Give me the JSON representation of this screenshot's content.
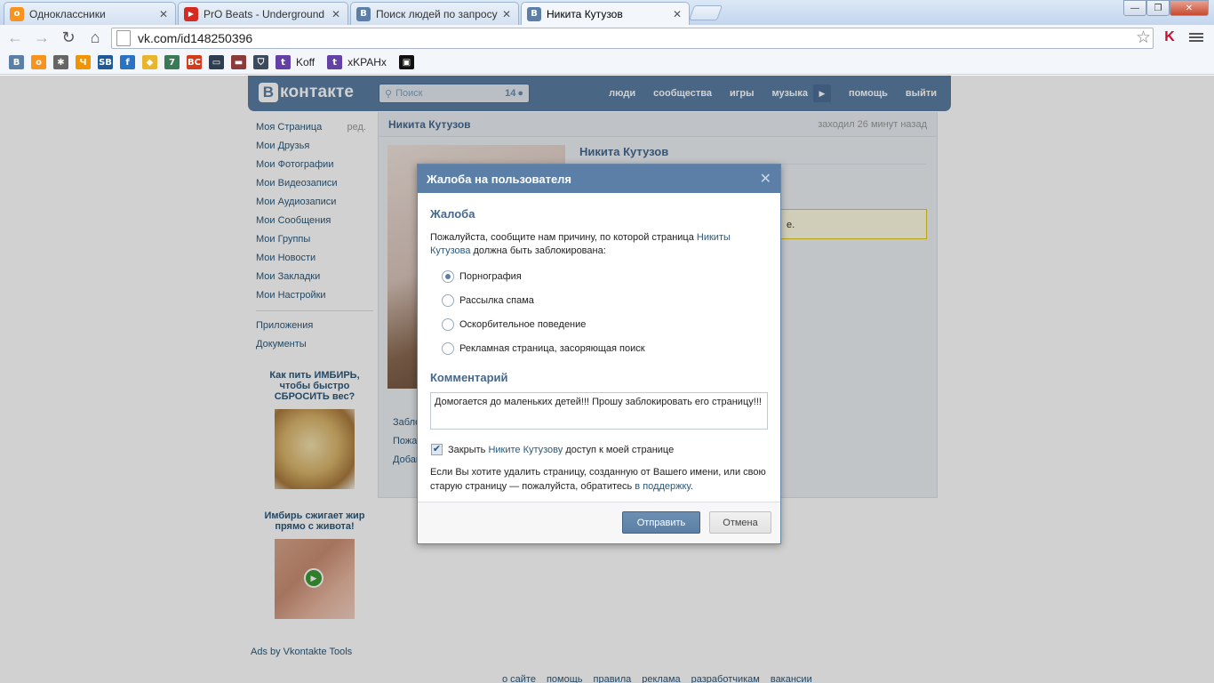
{
  "browser": {
    "tabs": [
      {
        "title": "Одноклассники",
        "icon": "odnoklassniki-icon",
        "color": "#f7931e",
        "glyph": "о"
      },
      {
        "title": "PrO Beats - Underground",
        "icon": "youtube-icon",
        "color": "#d42a20",
        "glyph": "▶"
      },
      {
        "title": "Поиск людей по запросу",
        "icon": "vk-icon",
        "color": "#5b7fa6",
        "glyph": "B"
      },
      {
        "title": "Никита Кутузов",
        "icon": "vk-icon",
        "color": "#5b7fa6",
        "glyph": "B"
      }
    ],
    "close_glyph": "✕",
    "url": "vk.com/id148250396",
    "bookmarks": {
      "koff": "Koff",
      "xkran": "xKPAHx"
    }
  },
  "vk": {
    "logo": "контакте",
    "logo_letter": "B",
    "search_placeholder": "Поиск",
    "search_count": "14",
    "nav": [
      "люди",
      "сообщества",
      "игры",
      "музыка",
      "помощь",
      "выйти"
    ],
    "menu": [
      "Моя Страница",
      "Мои Друзья",
      "Мои Фотографии",
      "Мои Видеозаписи",
      "Мои Аудиозаписи",
      "Мои Сообщения",
      "Мои Группы",
      "Мои Новости",
      "Мои Закладки",
      "Мои Настройки"
    ],
    "menu_edit": "ред.",
    "menu_extra": [
      "Приложения",
      "Документы"
    ],
    "ad1": "Как пить ИМБИРЬ, чтобы быстро СБРОСИТЬ вес?",
    "ad2": "Имбирь сжигает жир прямо с живота!",
    "ads_by": "Ads by Vkontakte Tools",
    "profile": {
      "name": "Никита Кутузов",
      "last_seen": "заходил 26 минут назад",
      "notice_tail": "е.",
      "side_actions": [
        "Забло",
        "Пожа",
        "Добав"
      ]
    },
    "footer": [
      "о сайте",
      "помощь",
      "правила",
      "реклама",
      "разработчикам",
      "вакансии"
    ]
  },
  "modal": {
    "title": "Жалоба на пользователя",
    "close": "✕",
    "section_complaint": "Жалоба",
    "desc_pre": "Пожалуйста, сообщите нам причину, по которой страница ",
    "desc_link": "Никиты Кутузова",
    "desc_post": " должна быть заблокирована:",
    "reasons": [
      "Порнография",
      "Рассылка спама",
      "Оскорбительное поведение",
      "Рекламная страница, засоряющая поиск"
    ],
    "selected_reason": 0,
    "section_comment": "Комментарий",
    "comment": "Домогается до маленьких детей!!! Прошу заблокировать его страницу!!!",
    "close_access_pre": "Закрыть ",
    "close_access_link": "Никите Кутузову",
    "close_access_post": " доступ к моей странице",
    "close_access_checked": true,
    "note_pre": "Если Вы хотите удалить страницу, созданную от Вашего имени, или свою старую страницу — пожалуйста, обратитесь ",
    "note_link": "в поддержку",
    "note_post": ".",
    "send": "Отправить",
    "cancel": "Отмена"
  }
}
